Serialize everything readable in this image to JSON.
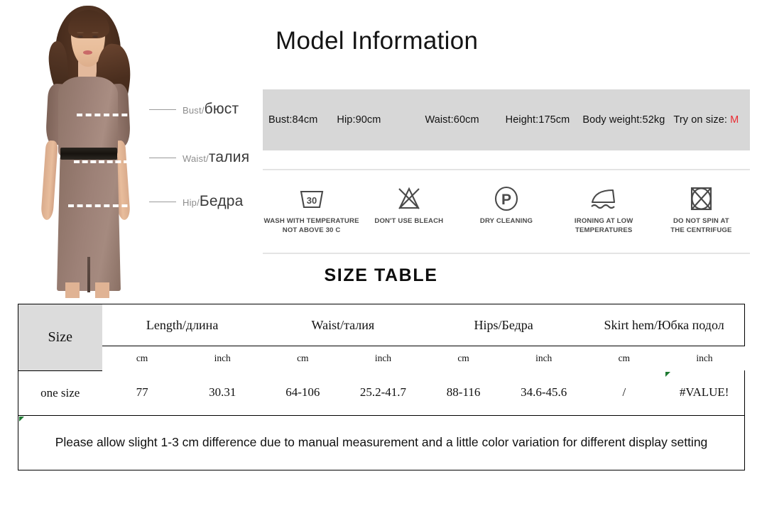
{
  "title": "Model Information",
  "model_callouts": [
    {
      "en": "Bust/",
      "ru": "бюст"
    },
    {
      "en": "Waist/",
      "ru": "талия"
    },
    {
      "en": "Hip/",
      "ru": "Бедра"
    }
  ],
  "model_measurements": {
    "bust": "Bust:84cm",
    "hip": "Hip:90cm",
    "waist": "Waist:60cm",
    "height": "Height:175cm",
    "body_weight": "Body weight:52kg",
    "try_on_size_label": "Try on size:",
    "try_on_size_value": "M",
    "try_on_size_color": "#ea2b32",
    "band_color": "#d7d7d7"
  },
  "care_symbols": [
    {
      "icon": "wash-tub-30-icon",
      "label": "WASH WITH TEMPERATURE\nNOT ABOVE 30 C"
    },
    {
      "icon": "no-bleach-triangle-icon",
      "label": "DON'T USE BLEACH"
    },
    {
      "icon": "dry-clean-circle-p-icon",
      "label": "DRY CLEANING"
    },
    {
      "icon": "iron-low-temperature-icon",
      "label": "IRONING AT LOW\nTEMPERATURES"
    },
    {
      "icon": "no-spin-centrifuge-icon",
      "label": "DO NOT SPIN AT\nTHE CENTRIFUGE"
    }
  ],
  "size_table": {
    "heading": "SIZE TABLE",
    "size_header": "Size",
    "columns": [
      "Length/длина",
      "Waist/талия",
      "Hips/Бедра",
      "Skirt hem/Юбка подол"
    ],
    "units": [
      "cm",
      "inch",
      "cm",
      "inch",
      "cm",
      "inch",
      "cm",
      "inch"
    ],
    "rows": [
      {
        "size": "one size",
        "values": [
          "77",
          "30.31",
          "64-106",
          "25.2-41.7",
          "88-116",
          "34.6-45.6",
          "/",
          "#VALUE!"
        ]
      }
    ],
    "note": "Please allow slight 1-3 cm difference due to manual measurement and a little color variation for different display setting"
  }
}
